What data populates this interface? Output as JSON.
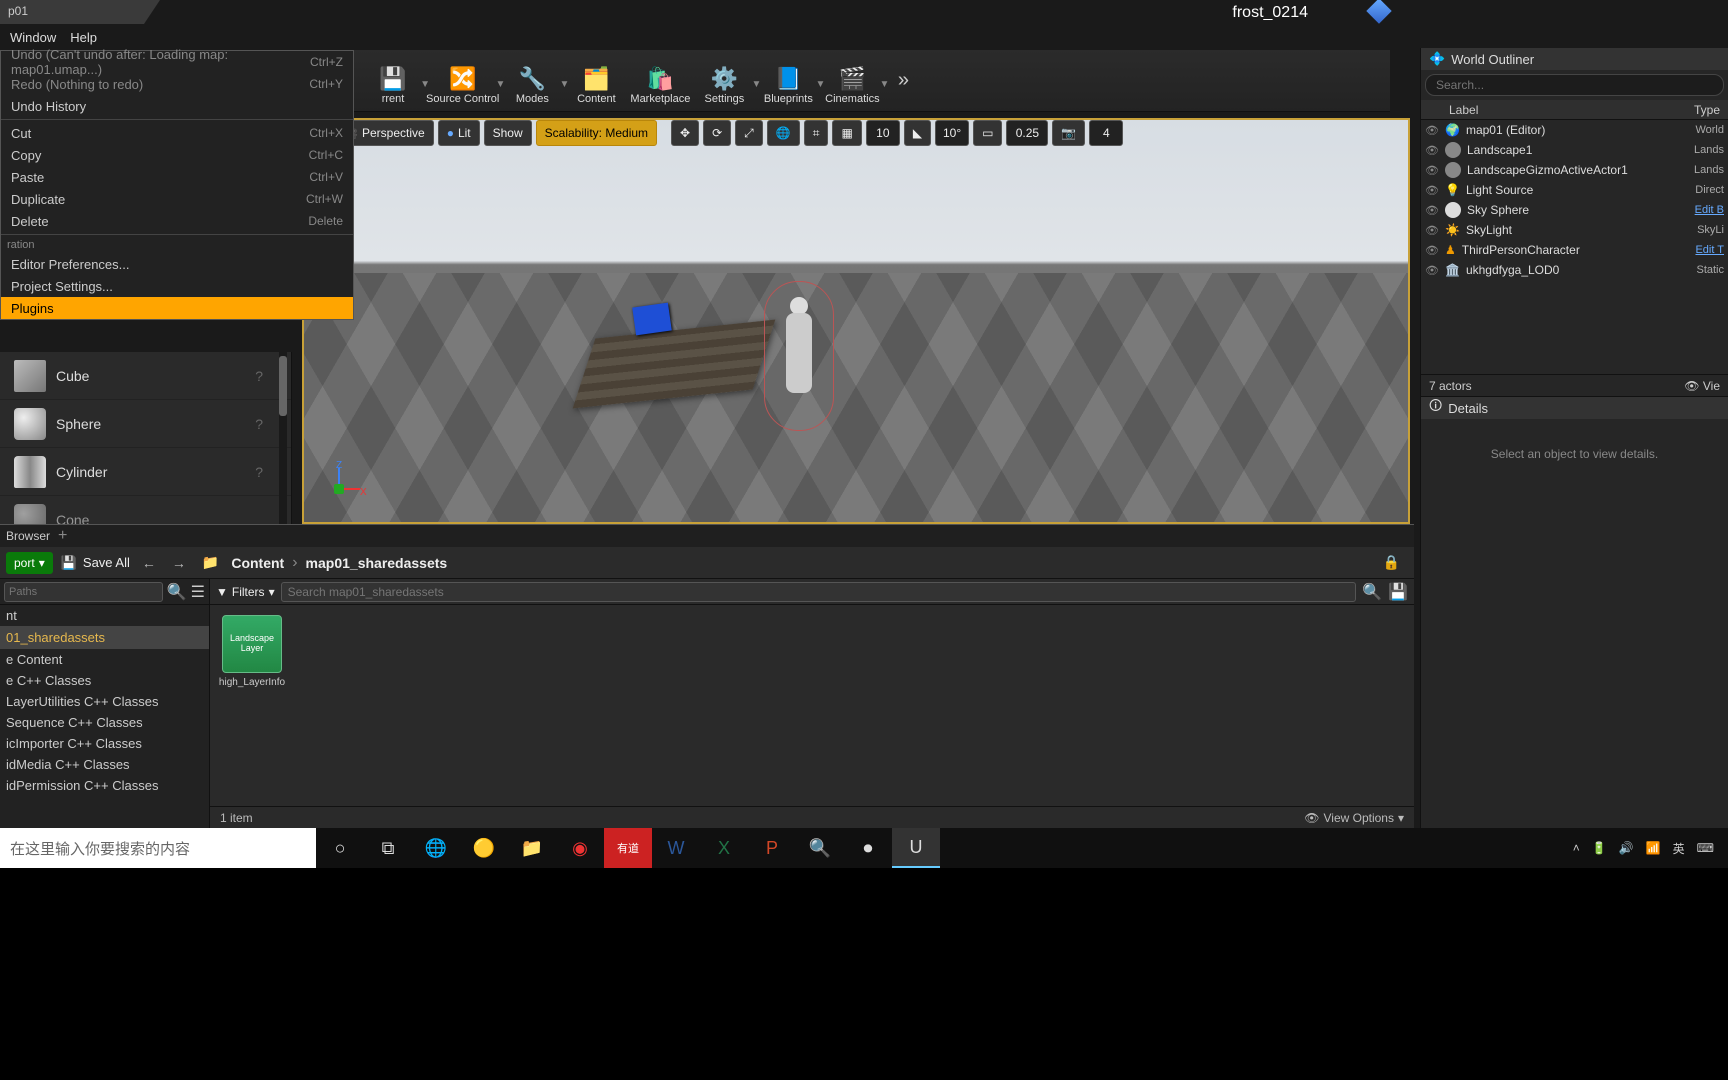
{
  "title_tab": "p01",
  "username": "frost_0214",
  "menubar": {
    "window": "Window",
    "help": "Help"
  },
  "edit_menu": {
    "undo": "Undo (Can't undo after: Loading map: map01.umap...)",
    "undo_sc": "Ctrl+Z",
    "redo": "Redo (Nothing to redo)",
    "redo_sc": "Ctrl+Y",
    "undo_history": "Undo History",
    "cut": "Cut",
    "cut_sc": "Ctrl+X",
    "copy": "Copy",
    "copy_sc": "Ctrl+C",
    "paste": "Paste",
    "paste_sc": "Ctrl+V",
    "duplicate": "Duplicate",
    "duplicate_sc": "Ctrl+W",
    "delete": "Delete",
    "delete_sc": "Delete",
    "config_header": "ration",
    "editor_prefs": "Editor Preferences...",
    "project_settings": "Project Settings...",
    "plugins": "Plugins"
  },
  "toolbar": {
    "current": "rrent",
    "source_control": "Source Control",
    "modes": "Modes",
    "content": "Content",
    "marketplace": "Marketplace",
    "settings": "Settings",
    "blueprints": "Blueprints",
    "cinematics": "Cinematics"
  },
  "viewport_bar": {
    "perspective": "Perspective",
    "lit": "Lit",
    "show": "Show",
    "scalability": "Scalability: Medium",
    "grid_snap": "10",
    "angle_snap": "10°",
    "scale_snap": "0.25",
    "cam_speed": "4"
  },
  "palette": {
    "cube": "Cube",
    "sphere": "Sphere",
    "cylinder": "Cylinder",
    "cone": "Cone"
  },
  "outliner": {
    "title": "World Outliner",
    "search_ph": "Search...",
    "label": "Label",
    "type": "Type",
    "rows": [
      {
        "label": "map01 (Editor)",
        "type": "World"
      },
      {
        "label": "Landscape1",
        "type": "Lands"
      },
      {
        "label": "LandscapeGizmoActiveActor1",
        "type": "Lands"
      },
      {
        "label": "Light Source",
        "type": "Direct"
      },
      {
        "label": "Sky Sphere",
        "type": "Edit B",
        "link": true
      },
      {
        "label": "SkyLight",
        "type": "SkyLi"
      },
      {
        "label": "ThirdPersonCharacter",
        "type": "Edit T",
        "link": true
      },
      {
        "label": "ukhgdfyga_LOD0",
        "type": "Static"
      }
    ],
    "footer_count": "7 actors",
    "footer_view": "Vie"
  },
  "details": {
    "title": "Details",
    "empty": "Select an object to view details."
  },
  "content_browser": {
    "tab": "Browser",
    "import": "port",
    "save_all": "Save All",
    "crumb_root": "Content",
    "crumb_folder": "map01_sharedassets",
    "paths_ph": "Paths",
    "tree_sel_parent": "nt",
    "tree_sel": "01_sharedassets",
    "tree_items": [
      "e Content",
      "e C++ Classes",
      "LayerUtilities C++ Classes",
      "Sequence C++ Classes",
      "icImporter C++ Classes",
      "idMedia C++ Classes",
      "idPermission C++ Classes"
    ],
    "filters": "Filters",
    "search_ph": "Search map01_sharedassets",
    "asset_thumb": "Landscape Layer",
    "asset_name": "high_LayerInfo",
    "status_count": "1 item",
    "view_options": "View Options"
  },
  "taskbar": {
    "search_ph": "在这里输入你要搜索的内容",
    "ime": "英"
  }
}
